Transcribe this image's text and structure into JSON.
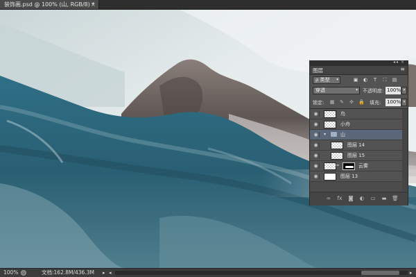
{
  "document_tab": {
    "title": "装饰画.psd @ 100% (山, RGB/8) *",
    "close": "×"
  },
  "status_bar": {
    "zoom": "100%",
    "doc_info": "文档:162.8M/436.3M",
    "arrow": "▸",
    "left": "◂",
    "right": "▸"
  },
  "layers_panel": {
    "title": "图层",
    "window_controls": "◂◂ ×",
    "menu": "≡",
    "filter": {
      "kind": "ρ 类型",
      "dropdown": "▾",
      "icons": [
        "▣",
        "◐",
        "T",
        "⛶",
        "▤"
      ]
    },
    "blend_mode": {
      "value": "穿透",
      "dropdown": "▾"
    },
    "opacity": {
      "label": "不透明度:",
      "value": "100%",
      "dropdown": "▾"
    },
    "lock": {
      "label": "锁定:",
      "icons": [
        "▦",
        "✎",
        "✣",
        "🔒"
      ]
    },
    "fill": {
      "label": "填充:",
      "value": "100%",
      "dropdown": "▾"
    },
    "layers": [
      {
        "name": "鸟",
        "eye": "◉"
      },
      {
        "name": "小舟",
        "eye": "◉"
      },
      {
        "name": "山",
        "eye": "◉",
        "group_toggle": "▾"
      },
      {
        "name": "图层 14",
        "eye": "◉"
      },
      {
        "name": "图层 15",
        "eye": "◉"
      },
      {
        "name": "云雾",
        "eye": "◉",
        "chain": "∞"
      },
      {
        "name": "图层 13",
        "eye": "◉"
      }
    ],
    "bottom_icons": [
      "∞",
      "fx",
      "◙",
      "◐",
      "▭",
      "▬",
      "🗑"
    ]
  },
  "colors": {
    "water": "#2f6a7e",
    "mountain": "#6e6561",
    "sky": "#e9eeee",
    "panel": "#535353",
    "selected_row": "#5a6778"
  }
}
